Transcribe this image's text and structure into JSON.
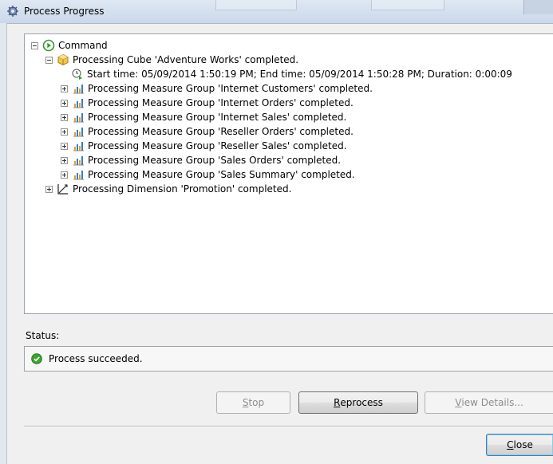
{
  "window": {
    "title": "Process Progress"
  },
  "tree": {
    "root": {
      "label": "Command"
    },
    "cube": {
      "label": "Processing Cube 'Adventure Works' completed."
    },
    "timing": {
      "label": "Start time: 05/09/2014 1:50:19 PM; End time: 05/09/2014 1:50:28 PM; Duration: 0:00:09"
    },
    "measure_groups": [
      {
        "label": "Processing Measure Group 'Internet Customers' completed."
      },
      {
        "label": "Processing Measure Group 'Internet Orders' completed."
      },
      {
        "label": "Processing Measure Group 'Internet Sales' completed."
      },
      {
        "label": "Processing Measure Group 'Reseller Orders' completed."
      },
      {
        "label": "Processing Measure Group 'Reseller Sales' completed."
      },
      {
        "label": "Processing Measure Group 'Sales Orders' completed."
      },
      {
        "label": "Processing Measure Group 'Sales Summary' completed."
      }
    ],
    "dimension": {
      "label": "Processing Dimension 'Promotion' completed."
    }
  },
  "status": {
    "label": "Status:",
    "message": "Process succeeded."
  },
  "buttons": {
    "stop": {
      "label": "Stop",
      "mnemonic": "S",
      "rest": "top"
    },
    "reprocess": {
      "label": "Reprocess",
      "mnemonic": "R",
      "rest": "eprocess"
    },
    "view_details": {
      "label": "View Details...",
      "mnemonic": "V",
      "rest": "iew Details..."
    },
    "close": {
      "label": "Close",
      "mnemonic": "C",
      "rest": "lose"
    }
  },
  "icons": {
    "root": "run-green-circle-icon",
    "cube": "cube-icon",
    "timing": "clock-icon",
    "measure_group": "bar-chart-icon",
    "dimension": "axis-icon",
    "status": "check-icon"
  },
  "colors": {
    "success": "#3aa52d",
    "cube": "#e8b83a",
    "accent": "#3c7fb1"
  }
}
